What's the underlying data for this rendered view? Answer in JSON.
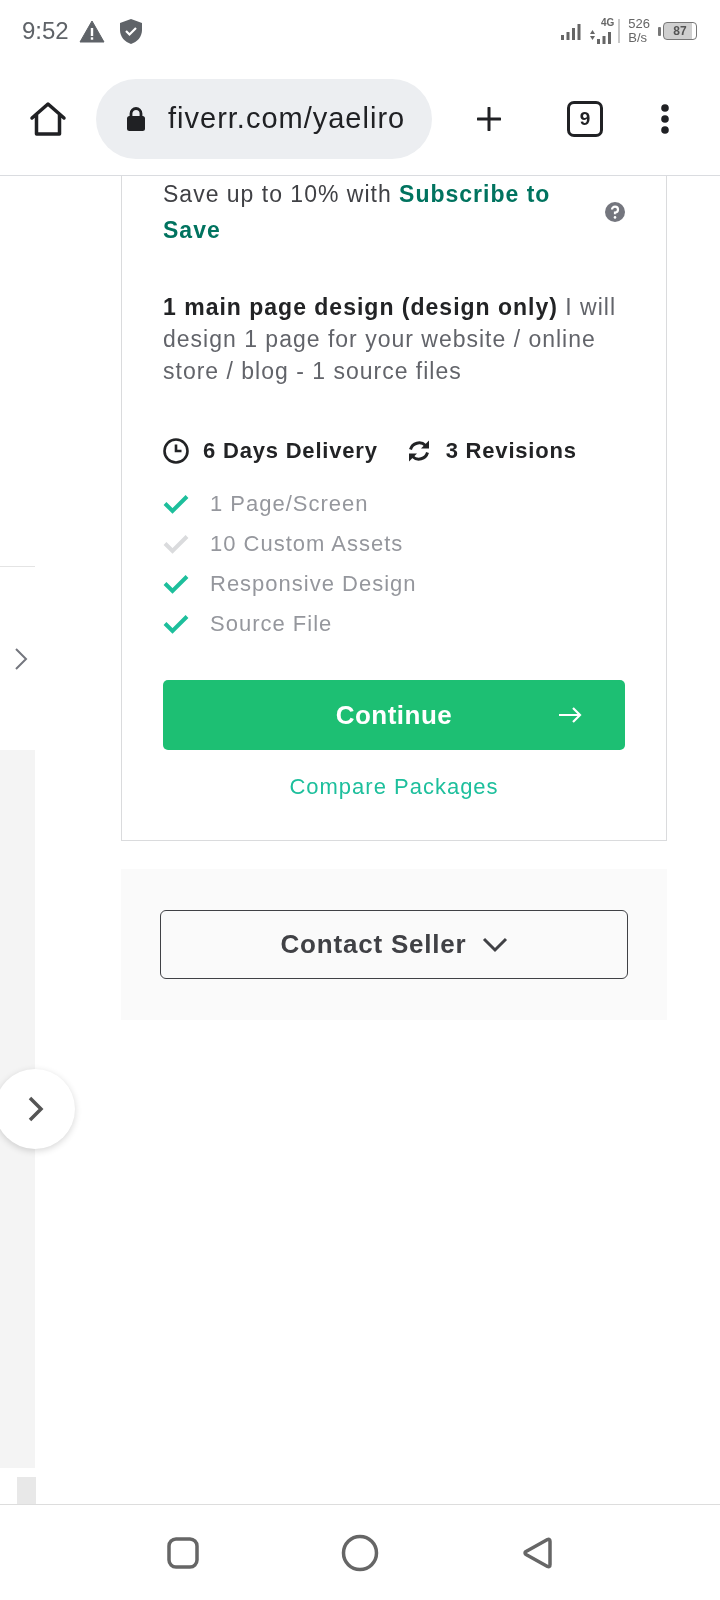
{
  "status_bar": {
    "time": "9:52",
    "network_type": "4G",
    "data_speed": "526 B/s",
    "battery": "87"
  },
  "browser_toolbar": {
    "url": "fiverr.com/yaeliro",
    "tab_count": "9"
  },
  "package_card": {
    "subscribe_note": "Save up to 10% with **Subscribe to Save**",
    "description": "**1 main page design (design only)** I will design 1 page for your website / online store / blog - 1 source files",
    "delivery": "6 Days Delivery",
    "revisions": "3 Revisions",
    "features": [
      {
        "label": "1 Page/Screen",
        "included": true
      },
      {
        "label": "10 Custom Assets",
        "included": false
      },
      {
        "label": "Responsive Design",
        "included": true
      },
      {
        "label": "Source File",
        "included": true
      }
    ],
    "continue_button": "Continue",
    "compare_link": "Compare Packages"
  },
  "contact_panel": {
    "button": "Contact Seller"
  }
}
